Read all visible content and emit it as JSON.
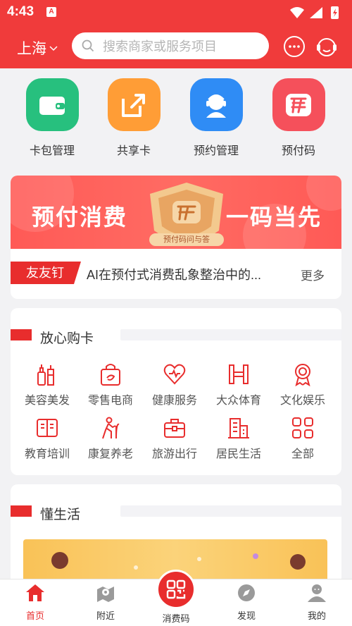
{
  "status": {
    "time": "4:43",
    "badge": "A"
  },
  "header": {
    "city": "上海",
    "search_placeholder": "搜索商家或服务项目"
  },
  "quick": [
    {
      "label": "卡包管理",
      "icon": "wallet-icon",
      "color": "#27c07e"
    },
    {
      "label": "共享卡",
      "icon": "share-card-icon",
      "color": "#ff9d36"
    },
    {
      "label": "预约管理",
      "icon": "customer-service-icon",
      "color": "#2f8cf5"
    },
    {
      "label": "预付码",
      "icon": "prepaid-code-icon",
      "color": "#f5505b"
    }
  ],
  "banner": {
    "left_text": "预付消费",
    "right_text": "一码当先",
    "caption": "预付码问与答"
  },
  "news": {
    "tag": "友友钉",
    "text": "AI在预付式消费乱象整治中的...",
    "more": "更多"
  },
  "shop": {
    "title": "放心购卡",
    "categories": [
      {
        "label": "美容美发",
        "icon": "beauty-icon"
      },
      {
        "label": "零售电商",
        "icon": "retail-icon"
      },
      {
        "label": "健康服务",
        "icon": "health-icon"
      },
      {
        "label": "大众体育",
        "icon": "sports-icon"
      },
      {
        "label": "文化娱乐",
        "icon": "culture-icon"
      },
      {
        "label": "教育培训",
        "icon": "education-icon"
      },
      {
        "label": "康复养老",
        "icon": "elderly-care-icon"
      },
      {
        "label": "旅游出行",
        "icon": "travel-icon"
      },
      {
        "label": "居民生活",
        "icon": "living-icon"
      },
      {
        "label": "全部",
        "icon": "all-grid-icon"
      }
    ]
  },
  "life": {
    "title": "懂生活"
  },
  "tabs": [
    {
      "label": "首页",
      "icon": "home-icon",
      "active": true
    },
    {
      "label": "附近",
      "icon": "map-pin-icon"
    },
    {
      "label": "消费码",
      "icon": "qr-code-icon"
    },
    {
      "label": "发现",
      "icon": "compass-icon"
    },
    {
      "label": "我的",
      "icon": "profile-icon"
    }
  ],
  "colors": {
    "brand": "#f03b3b",
    "accent": "#e82d2d"
  }
}
